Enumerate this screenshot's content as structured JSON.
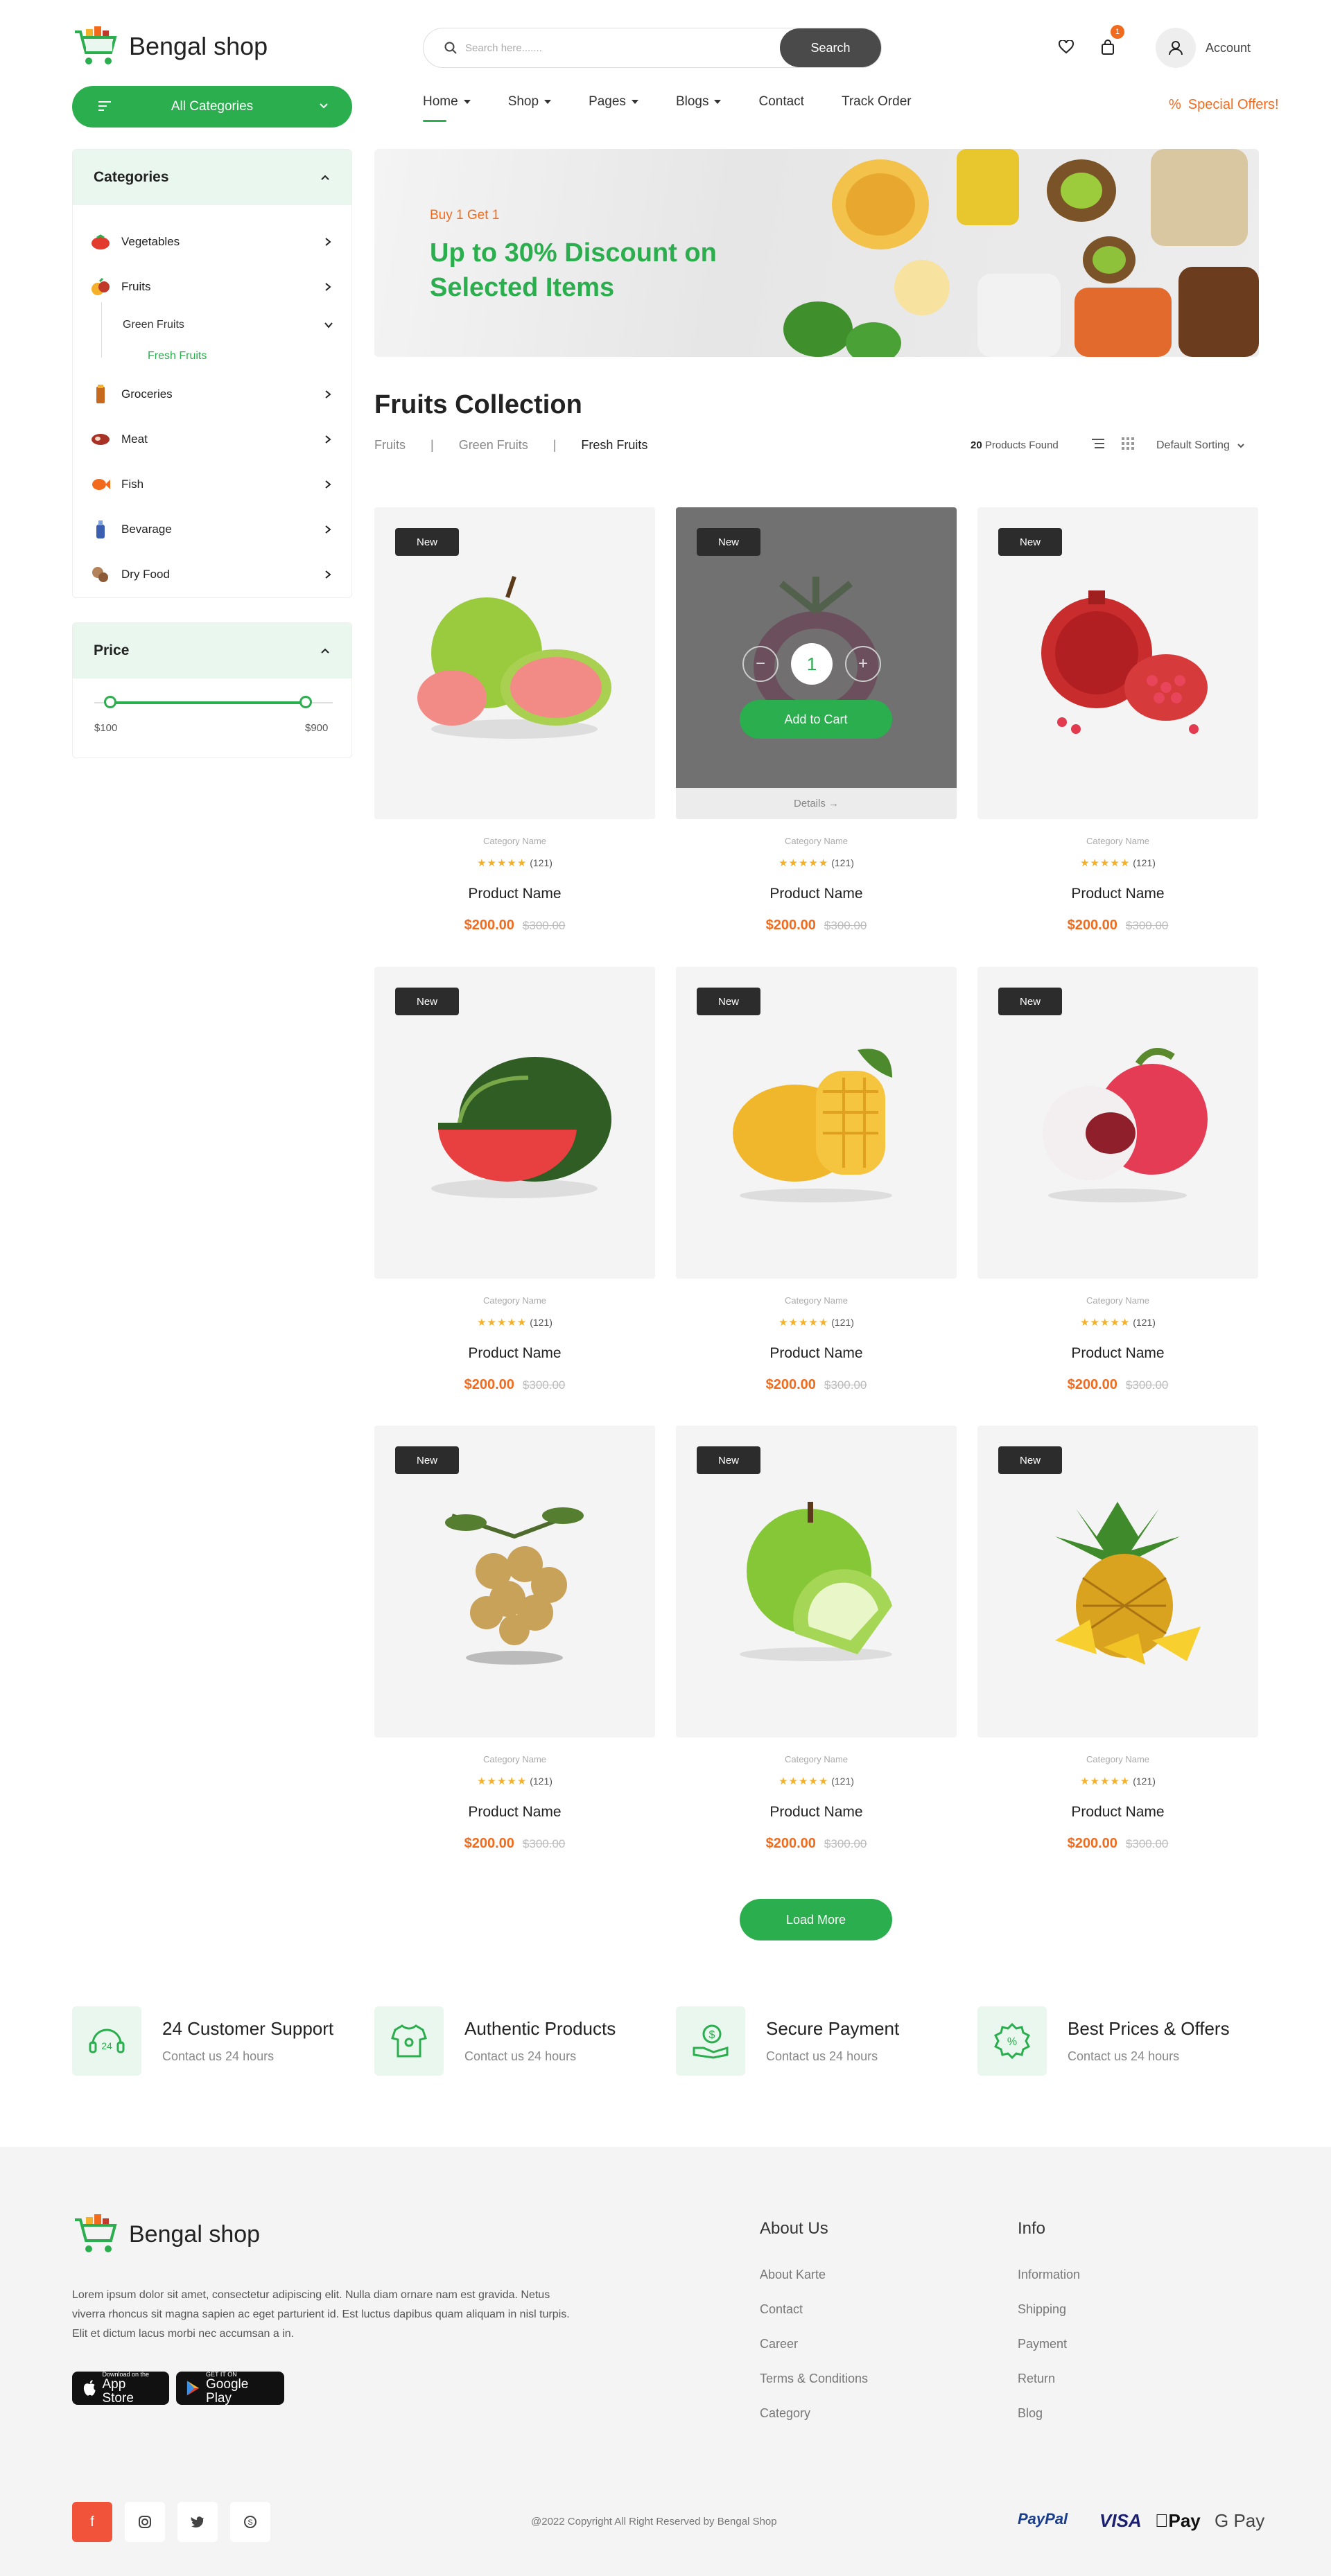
{
  "header": {
    "brand": "Bengal shop",
    "search_placeholder": "Search here.......",
    "search_button": "Search",
    "cart_count": "1",
    "account_label": "Account"
  },
  "nav": {
    "all_categories": "All Categories",
    "items": [
      "Home",
      "Shop",
      "Pages",
      "Blogs",
      "Contact",
      "Track Order"
    ],
    "special_offers": "Special Offers!"
  },
  "sidebar": {
    "categories_title": "Categories",
    "categories": [
      "Vegetables",
      "Fruits",
      "Green Fruits",
      "Fresh Fruits",
      "Groceries",
      "Meat",
      "Fish",
      "Bevarage",
      "Dry Food"
    ],
    "price_title": "Price",
    "price_min": "$100",
    "price_max": "$900"
  },
  "banner": {
    "small": "Buy 1 Get 1",
    "headline": "Up to 30% Discount on Selected Items"
  },
  "collection": {
    "title": "Fruits Collection",
    "breadcrumb": [
      "Fruits",
      "Green Fruits",
      "Fresh Fruits"
    ],
    "found_count": "20",
    "found_label": "Products Found",
    "sort": "Default Sorting"
  },
  "product": {
    "badge": "New",
    "category": "Category Name",
    "rating_count": "(121)",
    "name": "Product Name",
    "price": "$200.00",
    "old_price": "$300.00",
    "qty": "1",
    "add_to_cart": "Add to Cart",
    "details": "Details"
  },
  "load_more": "Load More",
  "features": [
    {
      "title": "24 Customer Support",
      "sub": "Contact us 24 hours"
    },
    {
      "title": "Authentic Products",
      "sub": "Contact us 24 hours"
    },
    {
      "title": "Secure Payment",
      "sub": "Contact us 24 hours"
    },
    {
      "title": "Best Prices & Offers",
      "sub": "Contact us 24 hours"
    }
  ],
  "footer": {
    "brand": "Bengal shop",
    "description": "Lorem ipsum dolor sit amet, consectetur adipiscing elit. Nulla diam ornare nam est gravida. Netus viverra rhoncus sit magna sapien ac eget parturient id. Est luctus dapibus quam aliquam in nisl turpis. Elit et dictum lacus morbi nec accumsan a in.",
    "app_store_small": "Download on the",
    "app_store": "App Store",
    "google_small": "GET IT ON",
    "google": "Google Play",
    "about_title": "About Us",
    "about_links": [
      "About Karte",
      "Contact",
      "Career",
      "Terms & Conditions",
      "Category"
    ],
    "info_title": "Info",
    "info_links": [
      "Information",
      "Shipping",
      "Payment",
      "Return",
      "Blog"
    ],
    "copyright": "@2022 Copyright All Right Reserved by Bengal Shop",
    "payments": [
      "PayPal",
      "VISA",
      "Pay",
      "G Pay"
    ]
  },
  "colors": {
    "accent": "#2bae4e",
    "orange": "#f26b1d",
    "dark": "#2c2c2c"
  }
}
